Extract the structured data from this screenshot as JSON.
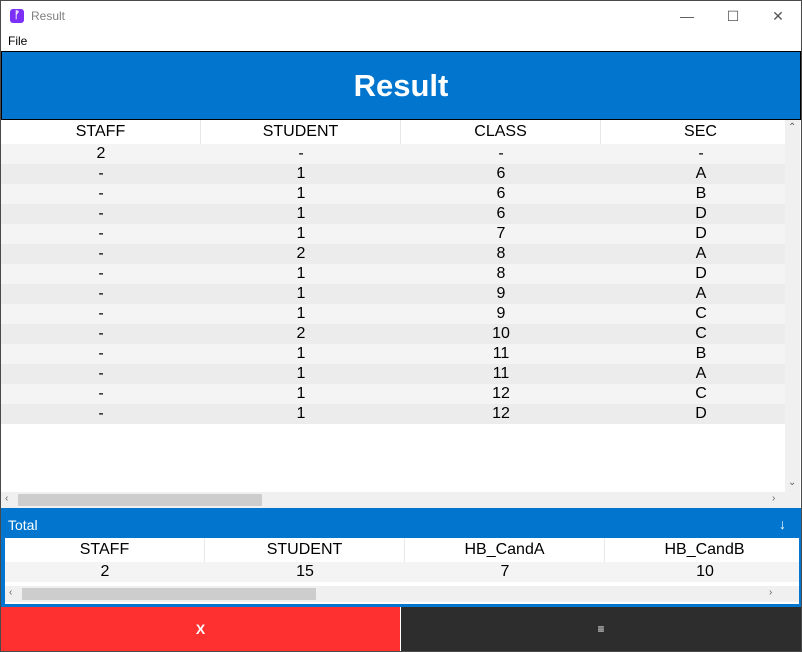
{
  "window": {
    "title": "Result",
    "app_icon": "feather-icon"
  },
  "menu": {
    "file": "File"
  },
  "header": {
    "title": "Result"
  },
  "table": {
    "columns": [
      "STAFF",
      "STUDENT",
      "CLASS",
      "SEC"
    ],
    "rows": [
      [
        "2",
        "-",
        "-",
        "-"
      ],
      [
        "-",
        "1",
        "6",
        "A"
      ],
      [
        "-",
        "1",
        "6",
        "B"
      ],
      [
        "-",
        "1",
        "6",
        "D"
      ],
      [
        "-",
        "1",
        "7",
        "D"
      ],
      [
        "-",
        "2",
        "8",
        "A"
      ],
      [
        "-",
        "1",
        "8",
        "D"
      ],
      [
        "-",
        "1",
        "9",
        "A"
      ],
      [
        "-",
        "1",
        "9",
        "C"
      ],
      [
        "-",
        "2",
        "10",
        "C"
      ],
      [
        "-",
        "1",
        "11",
        "B"
      ],
      [
        "-",
        "1",
        "11",
        "A"
      ],
      [
        "-",
        "1",
        "12",
        "C"
      ],
      [
        "-",
        "1",
        "12",
        "D"
      ]
    ]
  },
  "total": {
    "label": "Total",
    "arrow": "↓",
    "columns": [
      "STAFF",
      "STUDENT",
      "HB_CandA",
      "HB_CandB"
    ],
    "values": [
      "2",
      "15",
      "7",
      "10"
    ]
  },
  "buttons": {
    "close_label": "X",
    "menu_label": "≡"
  },
  "colors": {
    "accent": "#0276cf",
    "danger": "#ff3030",
    "dark": "#2d2d2d",
    "row_alt": "#ececec",
    "row": "#f4f4f4"
  }
}
